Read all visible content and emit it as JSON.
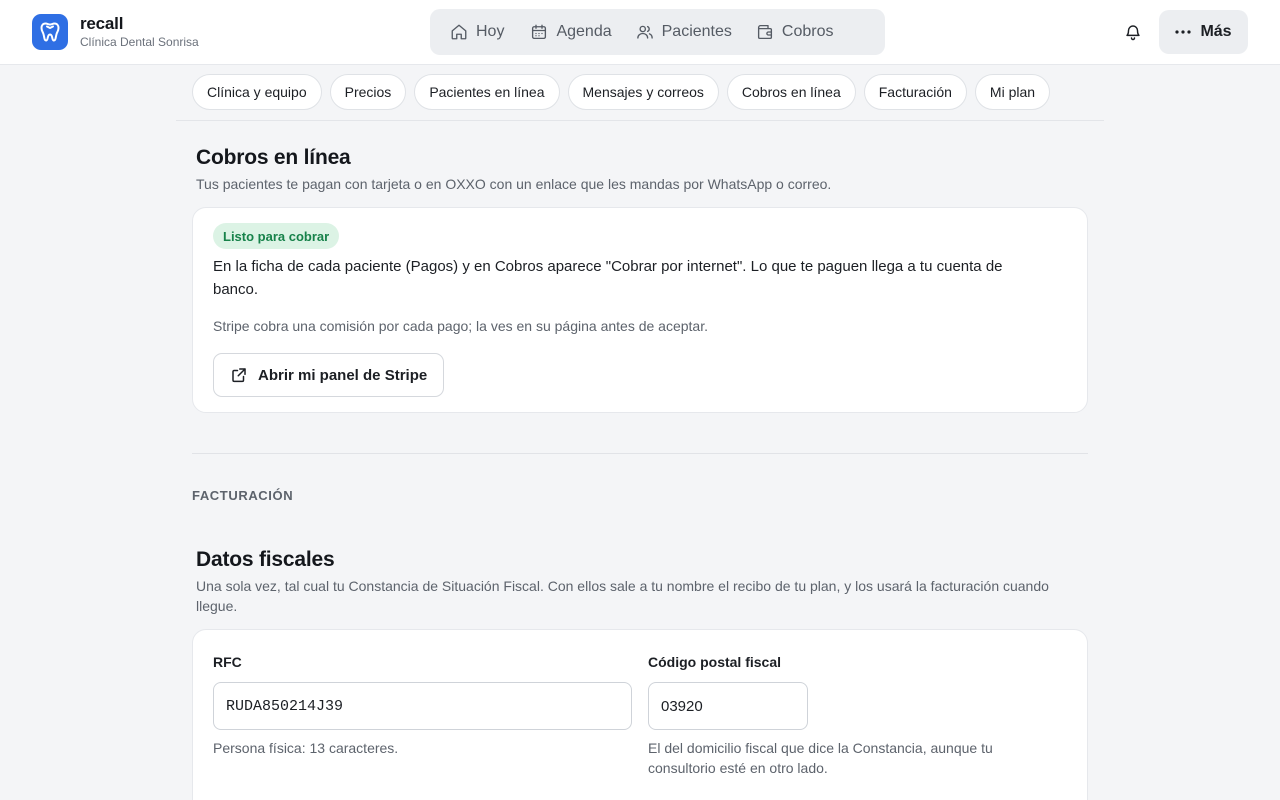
{
  "brand": {
    "name": "recall",
    "clinic": "Clínica Dental Sonrisa",
    "accent": "#2f6fe4"
  },
  "nav": {
    "items": [
      {
        "label": "Hoy",
        "icon": "home-icon"
      },
      {
        "label": "Agenda",
        "icon": "calendar-icon"
      },
      {
        "label": "Pacientes",
        "icon": "users-icon"
      },
      {
        "label": "Cobros",
        "icon": "wallet-icon"
      }
    ],
    "notifications_icon": "bell-icon",
    "more_label": "Más"
  },
  "tabs": [
    "Clínica y equipo",
    "Precios",
    "Pacientes en línea",
    "Mensajes y correos",
    "Cobros en línea",
    "Facturación",
    "Mi plan"
  ],
  "online_payments": {
    "title": "Cobros en línea",
    "description": "Tus pacientes te pagan con tarjeta o en OXXO con un enlace que les mandas por WhatsApp o correo.",
    "status_badge": "Listo para cobrar",
    "status_color": "#17824a",
    "body": "En la ficha de cada paciente (Pagos) y en Cobros aparece \"Cobrar por internet\". Lo que te paguen llega a tu cuenta de banco.",
    "note": "Stripe cobra una comisión por cada pago; la ves en su página antes de aceptar.",
    "stripe_button": "Abrir mi panel de Stripe"
  },
  "billing": {
    "group_label": "FACTURACIÓN",
    "title": "Datos fiscales",
    "description": "Una sola vez, tal cual tu Constancia de Situación Fiscal. Con ellos sale a tu nombre el recibo de tu plan, y los usará la facturación cuando llegue.",
    "rfc": {
      "label": "RFC",
      "value": "RUDA850214J39",
      "help": "Persona física: 13 caracteres."
    },
    "postal_code": {
      "label": "Código postal fiscal",
      "value": "03920",
      "help": "El del domicilio fiscal que dice la Constancia, aunque tu consultorio esté en otro lado."
    }
  }
}
